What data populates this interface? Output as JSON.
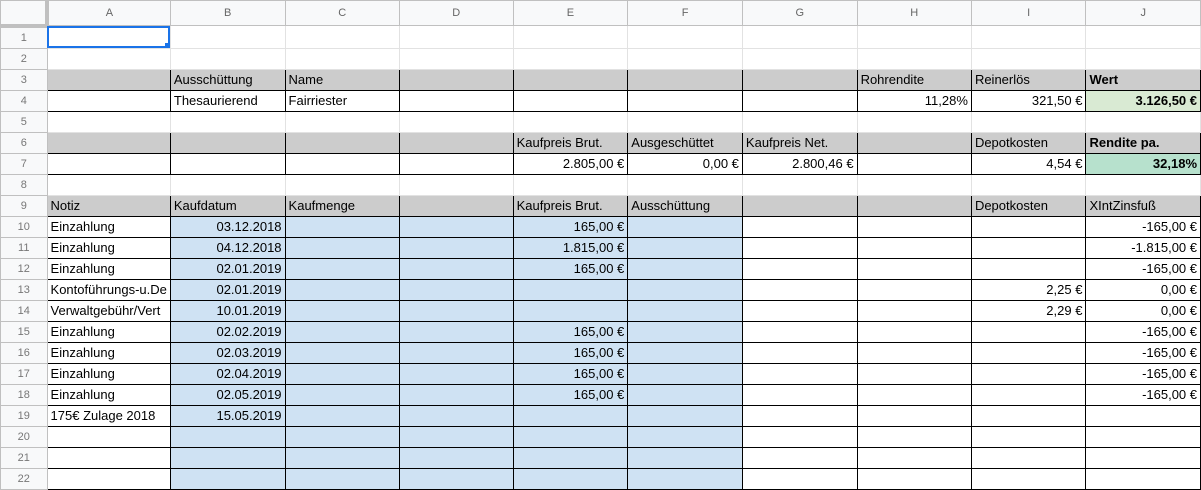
{
  "columns": [
    "A",
    "B",
    "C",
    "D",
    "E",
    "F",
    "G",
    "H",
    "I",
    "J"
  ],
  "rows": [
    {
      "num": "1",
      "cells": [
        "",
        "",
        "",
        "",
        "",
        "",
        "",
        "",
        "",
        ""
      ]
    },
    {
      "num": "2",
      "cells": [
        "",
        "",
        "",
        "",
        "",
        "",
        "",
        "",
        "",
        ""
      ]
    },
    {
      "num": "3",
      "cells": [
        "",
        "Ausschüttung",
        "Name",
        "",
        "",
        "",
        "",
        "Rohrendite",
        "Reinerlös",
        "Wert"
      ]
    },
    {
      "num": "4",
      "cells": [
        "",
        "Thesaurierend",
        "Fairriester",
        "",
        "",
        "",
        "",
        "11,28%",
        "321,50 €",
        "3.126,50 €"
      ]
    },
    {
      "num": "5",
      "cells": [
        "",
        "",
        "",
        "",
        "",
        "",
        "",
        "",
        "",
        ""
      ]
    },
    {
      "num": "6",
      "cells": [
        "",
        "",
        "",
        "",
        "Kaufpreis Brut.",
        "Ausgeschüttet",
        "Kaufpreis Net.",
        "",
        "Depotkosten",
        "Rendite pa."
      ]
    },
    {
      "num": "7",
      "cells": [
        "",
        "",
        "",
        "",
        "2.805,00 €",
        "0,00 €",
        "2.800,46 €",
        "",
        "4,54 €",
        "32,18%"
      ]
    },
    {
      "num": "8",
      "cells": [
        "",
        "",
        "",
        "",
        "",
        "",
        "",
        "",
        "",
        ""
      ]
    },
    {
      "num": "9",
      "cells": [
        "Notiz",
        "Kaufdatum",
        "Kaufmenge",
        "",
        "Kaufpreis Brut.",
        "Ausschüttung",
        "",
        "",
        "Depotkosten",
        "XIntZinsfuß"
      ]
    },
    {
      "num": "10",
      "cells": [
        "Einzahlung",
        "03.12.2018",
        "",
        "",
        "165,00 €",
        "",
        "",
        "",
        "",
        "-165,00 €"
      ]
    },
    {
      "num": "11",
      "cells": [
        "Einzahlung",
        "04.12.2018",
        "",
        "",
        "1.815,00 €",
        "",
        "",
        "",
        "",
        "-1.815,00 €"
      ]
    },
    {
      "num": "12",
      "cells": [
        "Einzahlung",
        "02.01.2019",
        "",
        "",
        "165,00 €",
        "",
        "",
        "",
        "",
        "-165,00 €"
      ]
    },
    {
      "num": "13",
      "cells": [
        "Kontoführungs-u.De",
        "02.01.2019",
        "",
        "",
        "",
        "",
        "",
        "",
        "2,25 €",
        "0,00 €"
      ]
    },
    {
      "num": "14",
      "cells": [
        "Verwaltgebühr/Vert",
        "10.01.2019",
        "",
        "",
        "",
        "",
        "",
        "",
        "2,29 €",
        "0,00 €"
      ]
    },
    {
      "num": "15",
      "cells": [
        "Einzahlung",
        "02.02.2019",
        "",
        "",
        "165,00 €",
        "",
        "",
        "",
        "",
        "-165,00 €"
      ]
    },
    {
      "num": "16",
      "cells": [
        "Einzahlung",
        "02.03.2019",
        "",
        "",
        "165,00 €",
        "",
        "",
        "",
        "",
        "-165,00 €"
      ]
    },
    {
      "num": "17",
      "cells": [
        "Einzahlung",
        "02.04.2019",
        "",
        "",
        "165,00 €",
        "",
        "",
        "",
        "",
        "-165,00 €"
      ]
    },
    {
      "num": "18",
      "cells": [
        "Einzahlung",
        "02.05.2019",
        "",
        "",
        "165,00 €",
        "",
        "",
        "",
        "",
        "-165,00 €"
      ]
    },
    {
      "num": "19",
      "cells": [
        "175€ Zulage 2018",
        "15.05.2019",
        "",
        "",
        "",
        "",
        "",
        "",
        "",
        ""
      ]
    },
    {
      "num": "20",
      "cells": [
        "",
        "",
        "",
        "",
        "",
        "",
        "",
        "",
        "",
        ""
      ]
    },
    {
      "num": "21",
      "cells": [
        "",
        "",
        "",
        "",
        "",
        "",
        "",
        "",
        "",
        ""
      ]
    },
    {
      "num": "22",
      "cells": [
        "",
        "",
        "",
        "",
        "",
        "",
        "",
        "",
        "",
        ""
      ]
    }
  ],
  "selected_cell": "A1",
  "colors": {
    "header_gray": "#cccccc",
    "input_blue": "#cfe2f3",
    "wert_green": "#d9ead3",
    "rendite_green": "#b7e1cd",
    "selection": "#1a73e8"
  }
}
